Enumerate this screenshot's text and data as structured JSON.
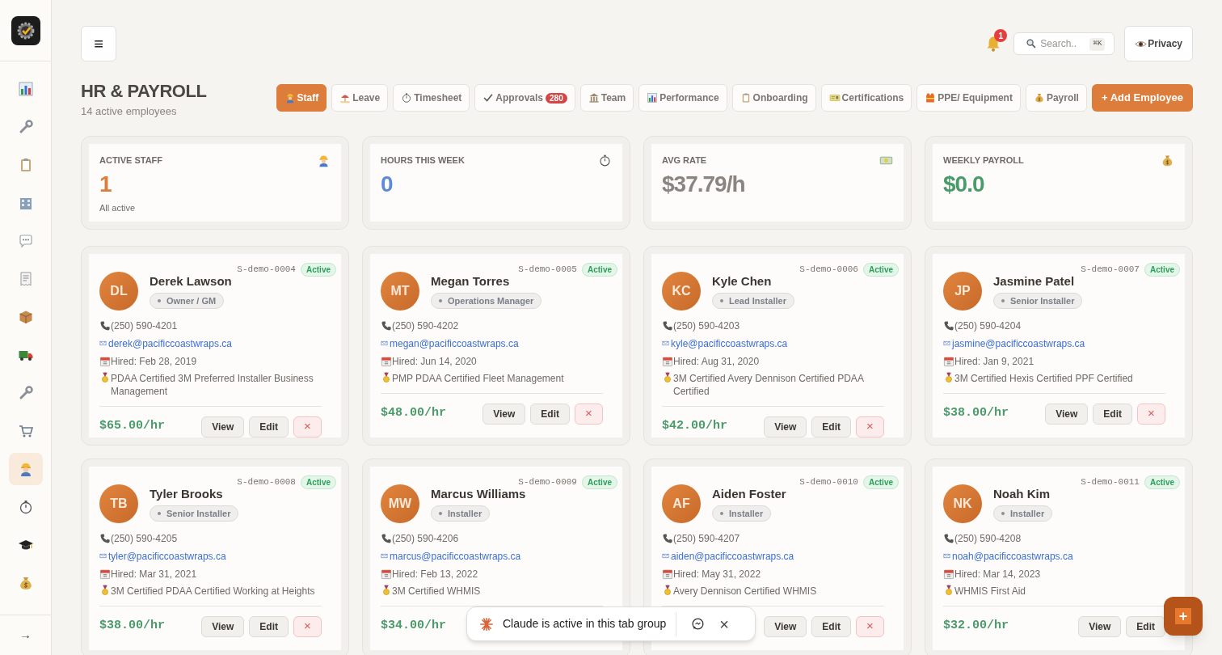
{
  "sidebar": {
    "items": [
      {
        "selected": false
      },
      {
        "selected": false
      },
      {
        "selected": false
      },
      {
        "selected": false
      },
      {
        "selected": false
      },
      {
        "selected": false
      },
      {
        "selected": false
      },
      {
        "selected": false
      },
      {
        "selected": false
      },
      {
        "selected": false
      },
      {
        "selected": true
      },
      {
        "selected": false
      },
      {
        "selected": false
      },
      {
        "selected": false
      }
    ],
    "collapse_label": "→"
  },
  "header": {
    "menu_label": "≡",
    "notifications": "1",
    "search": {
      "placeholder": "Search..",
      "shortcut": "⌘K"
    },
    "privacy_label": "Privacy"
  },
  "page": {
    "title": "HR & PAYROLL",
    "subtitle": "14 active employees"
  },
  "tabs": [
    {
      "label": "Staff",
      "selected": true
    },
    {
      "label": "Leave",
      "selected": false
    },
    {
      "label": "Timesheet",
      "selected": false
    },
    {
      "label": "Approvals",
      "selected": false,
      "badge": "280"
    },
    {
      "label": "Team",
      "selected": false
    },
    {
      "label": "Performance",
      "selected": false
    },
    {
      "label": "Onboarding",
      "selected": false
    },
    {
      "label": "Certifications",
      "selected": false
    },
    {
      "label": "PPE/ Equipment",
      "selected": false
    },
    {
      "label": "Payroll",
      "selected": false
    }
  ],
  "add_button": "+ Add Employee",
  "stats": [
    {
      "label": "ACTIVE STAFF",
      "value": "1",
      "note": "All active",
      "color": "#dc7d3c"
    },
    {
      "label": "HOURS THIS WEEK",
      "value": "0",
      "color": "#5b8bd8"
    },
    {
      "label": "AVG RATE",
      "value": "$37.79/h",
      "color": "#8a8580"
    },
    {
      "label": "WEEKLY PAYROLL",
      "value": "$0.0",
      "color": "#4a9a6a"
    }
  ],
  "employees": [
    {
      "initials": "DL",
      "name": "Derek Lawson",
      "role": "Owner / GM",
      "id": "S-demo-0004",
      "status": "Active",
      "phone": "(250) 590-4201",
      "email": "derek@pacificcoastwraps.ca",
      "hired": "Hired: Feb 28, 2019",
      "certs": "PDAA Certified 3M Preferred Installer Business Management",
      "rate": "$65.00/hr",
      "buttons": [
        "View",
        "Edit"
      ],
      "delete": "×"
    },
    {
      "initials": "MT",
      "name": "Megan Torres",
      "role": "Operations Manager",
      "id": "S-demo-0005",
      "status": "Active",
      "phone": "(250) 590-4202",
      "email": "megan@pacificcoastwraps.ca",
      "hired": "Hired: Jun 14, 2020",
      "certs": "PMP PDAA Certified Fleet Management",
      "rate": "$48.00/hr",
      "buttons": [
        "View",
        "Edit"
      ],
      "delete": "×"
    },
    {
      "initials": "KC",
      "name": "Kyle Chen",
      "role": "Lead Installer",
      "id": "S-demo-0006",
      "status": "Active",
      "phone": "(250) 590-4203",
      "email": "kyle@pacificcoastwraps.ca",
      "hired": "Hired: Aug 31, 2020",
      "certs": "3M Certified Avery Dennison Certified PDAA Certified",
      "rate": "$42.00/hr",
      "buttons": [
        "View",
        "Edit"
      ],
      "delete": "×"
    },
    {
      "initials": "JP",
      "name": "Jasmine Patel",
      "role": "Senior Installer",
      "id": "S-demo-0007",
      "status": "Active",
      "phone": "(250) 590-4204",
      "email": "jasmine@pacificcoastwraps.ca",
      "hired": "Hired: Jan 9, 2021",
      "certs": "3M Certified Hexis Certified PPF Certified",
      "rate": "$38.00/hr",
      "buttons": [
        "View",
        "Edit"
      ],
      "delete": "×"
    },
    {
      "initials": "TB",
      "name": "Tyler Brooks",
      "role": "Senior Installer",
      "id": "S-demo-0008",
      "status": "Active",
      "phone": "(250) 590-4205",
      "email": "tyler@pacificcoastwraps.ca",
      "hired": "Hired: Mar 31, 2021",
      "certs": "3M Certified PDAA Certified Working at Heights",
      "rate": "$38.00/hr",
      "buttons": [
        "View",
        "Edit"
      ],
      "delete": "×"
    },
    {
      "initials": "MW",
      "name": "Marcus Williams",
      "role": "Installer",
      "id": "S-demo-0009",
      "status": "Active",
      "phone": "(250) 590-4206",
      "email": "marcus@pacificcoastwraps.ca",
      "hired": "Hired: Feb 13, 2022",
      "certs": "3M Certified WHMIS",
      "rate": "$34.00/hr"
    },
    {
      "initials": "AF",
      "name": "Aiden Foster",
      "role": "Installer",
      "id": "S-demo-0010",
      "status": "Active",
      "phone": "(250) 590-4207",
      "email": "aiden@pacificcoastwraps.ca",
      "hired": "Hired: May 31, 2022",
      "certs": "Avery Dennison Certified WHMIS",
      "buttons": [
        "View",
        "Edit"
      ],
      "delete": "×"
    },
    {
      "initials": "NK",
      "name": "Noah Kim",
      "role": "Installer",
      "id": "S-demo-0011",
      "status": "Active",
      "phone": "(250) 590-4208",
      "email": "noah@pacificcoastwraps.ca",
      "hired": "Hired: Mar 14, 2023",
      "certs": "WHMIS First Aid",
      "rate": "$32.00/hr",
      "buttons": [
        "View",
        "Edit"
      ]
    }
  ],
  "toast": {
    "text": "Claude is active in this tab group",
    "close": "×"
  },
  "fab_label": "+"
}
